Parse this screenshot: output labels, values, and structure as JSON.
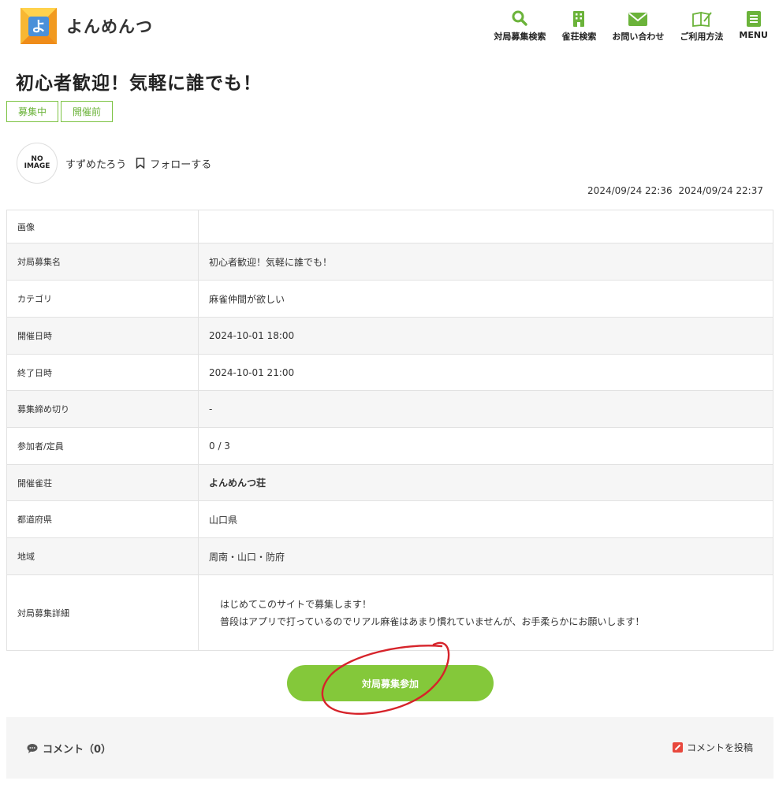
{
  "brand": {
    "logo_char": "よ",
    "name": "よんめんつ",
    "color": "#f5a623"
  },
  "nav": [
    {
      "label": "対局募集検索",
      "icon": "search-icon"
    },
    {
      "label": "雀荘検索",
      "icon": "building-icon"
    },
    {
      "label": "お問い合わせ",
      "icon": "mail-icon"
    },
    {
      "label": "ご利用方法",
      "icon": "book-icon"
    },
    {
      "label": "MENU",
      "icon": "menu-icon"
    }
  ],
  "post": {
    "title": "初心者歓迎！気軽に誰でも！",
    "tags": [
      "募集中",
      "開催前"
    ],
    "author": {
      "avatar_line1": "NO",
      "avatar_line2": "IMAGE",
      "name": "すずめたろう"
    },
    "follow_label": "フォローする",
    "created": "2024/09/24 22:36",
    "updated": "2024/09/24 22:37"
  },
  "details": [
    {
      "label": "画像",
      "value": ""
    },
    {
      "label": "対局募集名",
      "value": "初心者歓迎！気軽に誰でも！"
    },
    {
      "label": "カテゴリ",
      "value": "麻雀仲間が欲しい"
    },
    {
      "label": "開催日時",
      "value": "2024-10-01 18:00"
    },
    {
      "label": "終了日時",
      "value": "2024-10-01 21:00"
    },
    {
      "label": "募集締め切り",
      "value": "-"
    },
    {
      "label": "参加者/定員",
      "value": "0 / 3"
    },
    {
      "label": "開催雀荘",
      "value": "よんめんつ荘"
    },
    {
      "label": "都道府県",
      "value": "山口県"
    },
    {
      "label": "地域",
      "value": "周南・山口・防府"
    }
  ],
  "description": {
    "label": "対局募集詳細",
    "lines": [
      "はじめてこのサイトで募集します！",
      "普段はアプリで打っているのでリアル麻雀はあまり慣れていませんが、お手柔らかにお願いします！"
    ]
  },
  "join_button": "対局募集参加",
  "comments": {
    "title": "コメント（0）",
    "post_label": "コメントを投稿"
  },
  "colors": {
    "accent": "#84c83a",
    "tag": "#6bb33a",
    "annotation": "#d6232a"
  }
}
